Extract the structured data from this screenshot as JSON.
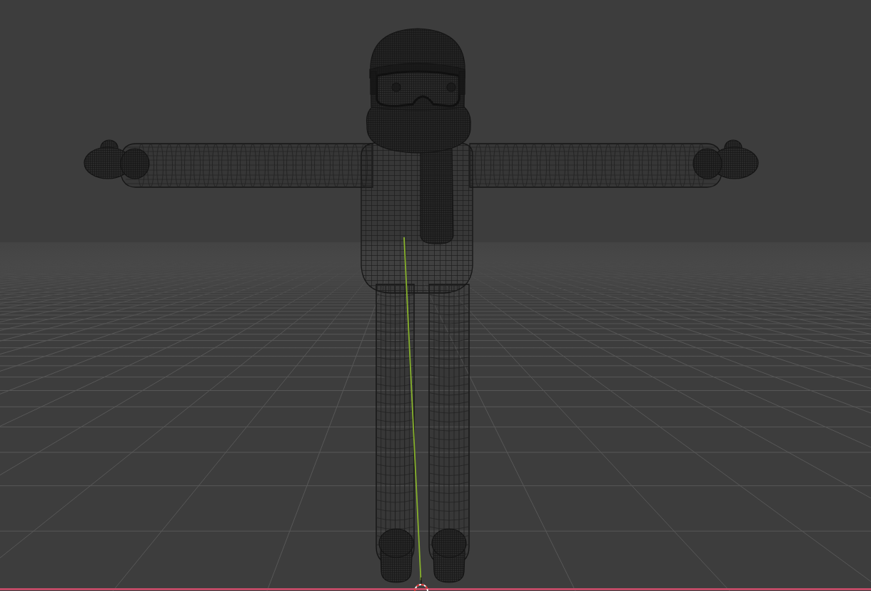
{
  "viewport": {
    "grid": true,
    "axes": {
      "x": true,
      "y": true
    },
    "cursor_3d": true,
    "object": {
      "wireframe": true
    }
  }
}
